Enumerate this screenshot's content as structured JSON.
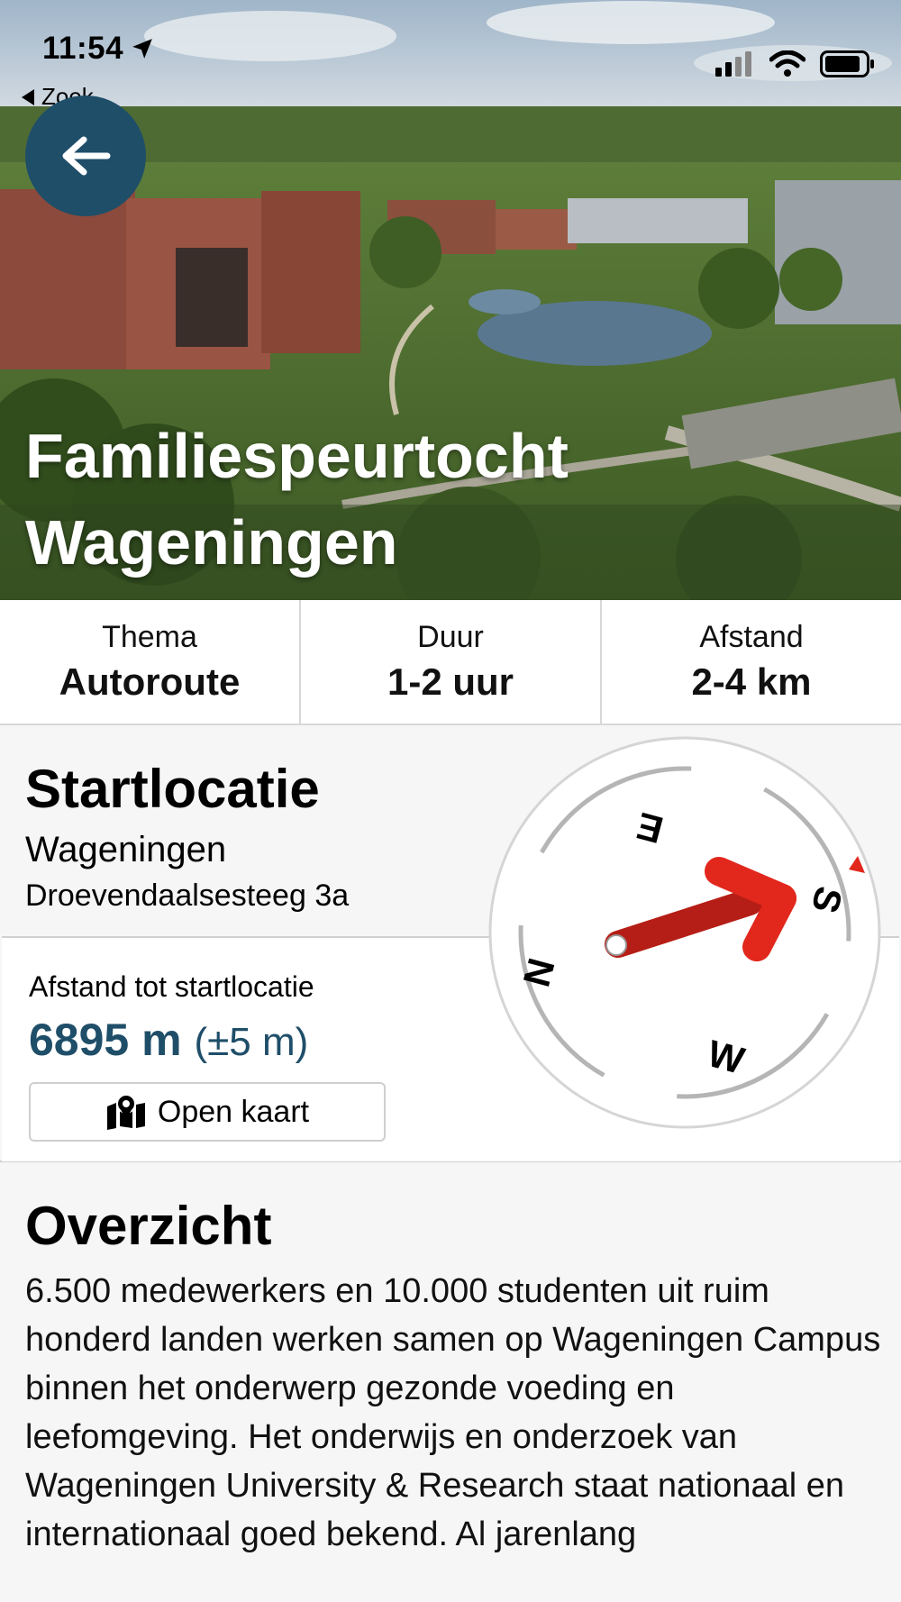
{
  "status_bar": {
    "time": "11:54",
    "back_app": "Zoek"
  },
  "hero": {
    "title": "Familiespeurtocht Wageningen"
  },
  "info": [
    {
      "label": "Thema",
      "value": "Autoroute"
    },
    {
      "label": "Duur",
      "value": "1-2 uur"
    },
    {
      "label": "Afstand",
      "value": "2-4 km"
    }
  ],
  "start": {
    "heading": "Startlocatie",
    "city": "Wageningen",
    "street": "Droevendaalsesteeg 3a",
    "distance_label": "Afstand tot startlocatie",
    "distance_value": "6895 m",
    "distance_accuracy": "(±5 m)",
    "map_button": "Open kaart"
  },
  "compass": {
    "labels": {
      "n": "N",
      "e": "E",
      "s": "S",
      "w": "W"
    },
    "needle_color": "#e2271c"
  },
  "overview": {
    "heading": "Overzicht",
    "text": "6.500 medewerkers en 10.000 studenten uit ruim honderd landen werken samen op Wageningen Campus binnen het onderwerp gezonde voeding en leefomgeving. Het onderwijs en onderzoek van Wageningen University & Research staat nationaal en internationaal goed bekend. Al jarenlang"
  },
  "colors": {
    "accent": "#1f4e69",
    "needle": "#e2271c"
  }
}
